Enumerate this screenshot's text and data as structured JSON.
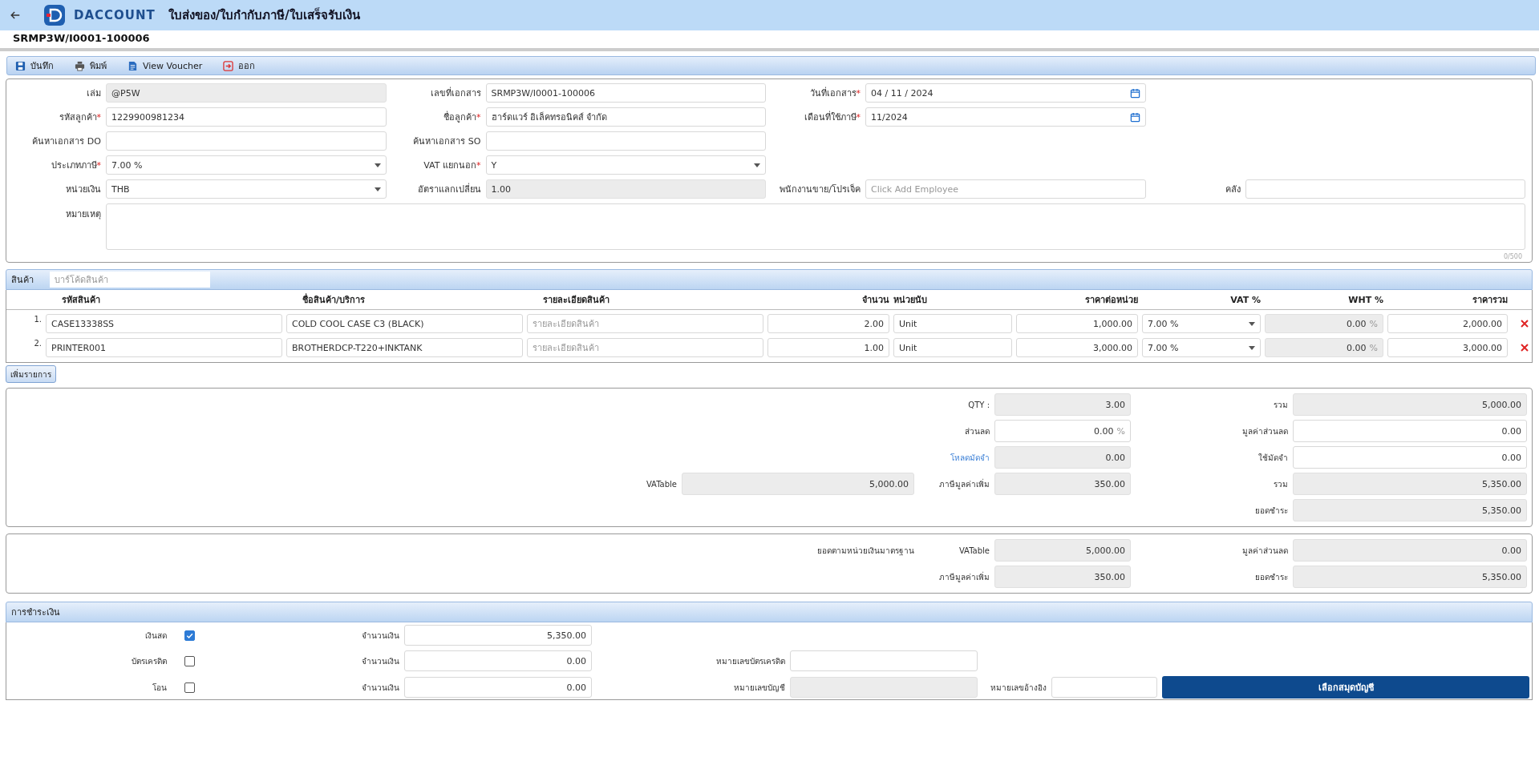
{
  "app": {
    "brand": "DACCOUNT",
    "title": "ใบส่งของ/ใบกำกับภาษี/ใบเสร็จรับเงิน"
  },
  "document_number": "SRMP3W/I0001-100006",
  "toolbar": [
    {
      "label": "บันทึก",
      "kind": "save"
    },
    {
      "label": "พิมพ์",
      "kind": "print"
    },
    {
      "label": "View Voucher",
      "kind": "voucher"
    },
    {
      "label": "ออก",
      "kind": "exit"
    }
  ],
  "form": {
    "rows": [
      [
        {
          "label": "เล่ม",
          "kind": "readonly",
          "value": "@P5W"
        },
        {
          "label": "เลขที่เอกสาร",
          "kind": "text",
          "value": "SRMP3W/I0001-100006"
        },
        {
          "label": "วันที่เอกสาร",
          "required_mark": "*",
          "kind": "date",
          "value": "04 / 11 /  2024"
        }
      ],
      [
        {
          "label": "รหัสลูกค้า",
          "required_mark": "*",
          "kind": "text",
          "value": "1229900981234"
        },
        {
          "label": "ชื่อลูกค้า",
          "required_mark": "*",
          "kind": "text",
          "value": "ฮาร์ดแวร์ อิเล็คทรอนิคส์ จำกัด"
        },
        {
          "label": "เดือนที่ใช้ภาษี",
          "required_mark": "*",
          "kind": "date",
          "value": "11/2024"
        }
      ],
      [
        {
          "label": "ค้นหาเอกสาร DO",
          "kind": "text"
        },
        {
          "label": "ค้นหาเอกสาร SO",
          "kind": "text"
        }
      ],
      [
        {
          "label": "ประเภทภาษี",
          "required_mark": "*",
          "kind": "select",
          "value": "7.00 %"
        },
        {
          "label": "VAT แยกนอก",
          "required_mark": "*",
          "kind": "select",
          "value": "Y"
        }
      ],
      [
        {
          "label": "หน่วยเงิน",
          "kind": "select",
          "value": "THB"
        },
        {
          "label": "อัตราแลกเปลี่ยน",
          "kind": "readonly",
          "value": "1.00"
        },
        {
          "label": "พนักงานขาย/โปรเจ็ค",
          "kind": "text",
          "placeholder": "Click Add Employee"
        },
        {
          "label": "คลัง",
          "kind": "text"
        }
      ]
    ],
    "remarks": {
      "label": "หมายเหตุ",
      "counter": "0/500"
    }
  },
  "items": {
    "title": "สินค้า",
    "barcode_placeholder": "บาร์โค้ดสินค้า",
    "columns": [
      "รหัสสินค้า",
      "ชื่อสินค้า/บริการ",
      "รายละเอียดสินค้า",
      "จำนวน",
      "หน่วยนับ",
      "ราคาต่อหน่วย",
      "VAT %",
      "WHT %",
      "ราคารวม"
    ],
    "rows": [
      {
        "no": "1.",
        "code": "CASE13338SS",
        "name": "COLD COOL CASE C3 (BLACK)",
        "detail_placeholder": "รายละเอียดสินค้า",
        "qty": "2.00",
        "unit": "Unit",
        "price": "1,000.00",
        "vat": "7.00 %",
        "wht": "0.00",
        "wht_unit": "%",
        "total": "2,000.00"
      },
      {
        "no": "2.",
        "code": "PRINTER001",
        "name": "BROTHERDCP-T220+INKTANK",
        "detail_placeholder": "รายละเอียดสินค้า",
        "qty": "1.00",
        "unit": "Unit",
        "price": "3,000.00",
        "vat": "7.00 %",
        "wht": "0.00",
        "wht_unit": "%",
        "total": "3,000.00"
      }
    ],
    "add_button": "เพิ่มรายการ"
  },
  "summary": {
    "rows": [
      {
        "middle": {
          "label": "QTY :",
          "value": "3.00",
          "readonly": true
        },
        "right": {
          "label": "รวม",
          "value": "5,000.00",
          "readonly": true
        }
      },
      {
        "middle": {
          "label": "ส่วนลด",
          "value": "0.00",
          "unit": "%",
          "readonly": false
        },
        "right": {
          "label": "มูลค่าส่วนลด",
          "value": "0.00",
          "readonly": false
        }
      },
      {
        "middle": {
          "label": "โหลดมัดจำ",
          "link": true,
          "value": "0.00",
          "readonly": true
        },
        "right": {
          "label": "ใช้มัดจำ",
          "value": "0.00",
          "readonly": false
        }
      },
      {
        "left": {
          "label": "VATable",
          "value": "5,000.00",
          "readonly": true
        },
        "middle": {
          "label": "ภาษีมูลค่าเพิ่ม",
          "value": "350.00",
          "readonly": true
        },
        "right": {
          "label": "รวม",
          "value": "5,350.00",
          "readonly": true
        }
      },
      {
        "right": {
          "label": "ยอดชำระ",
          "value": "5,350.00",
          "readonly": true
        }
      }
    ]
  },
  "base_currency": {
    "caption": "ยอดตามหน่วยเงินมาตรฐาน",
    "rows": [
      {
        "middle": {
          "label": "VATable",
          "value": "5,000.00",
          "readonly": true
        },
        "right": {
          "label": "มูลค่าส่วนลด",
          "value": "0.00",
          "readonly": true
        }
      },
      {
        "middle": {
          "label": "ภาษีมูลค่าเพิ่ม",
          "value": "350.00",
          "readonly": true
        },
        "right": {
          "label": "ยอดชำระ",
          "value": "5,350.00",
          "readonly": true
        }
      }
    ]
  },
  "payment": {
    "title": "การชำระเงิน",
    "rows": [
      {
        "method": "เงินสด",
        "checked": true,
        "amount_label": "จำนวนเงิน",
        "amount": "5,350.00"
      },
      {
        "method": "บัตรเครดิต",
        "checked": false,
        "amount_label": "จำนวนเงิน",
        "amount": "0.00",
        "extra": [
          {
            "label": "หมายเลขบัตรเครดิต",
            "readonly": false
          }
        ]
      },
      {
        "method": "โอน",
        "checked": false,
        "amount_label": "จำนวนเงิน",
        "amount": "0.00",
        "extra": [
          {
            "label": "หมายเลขบัญชี",
            "readonly": true
          },
          {
            "label": "หมายเลขอ้างอิง",
            "readonly": false
          }
        ],
        "button": "เลือกสมุดบัญชี"
      }
    ]
  }
}
